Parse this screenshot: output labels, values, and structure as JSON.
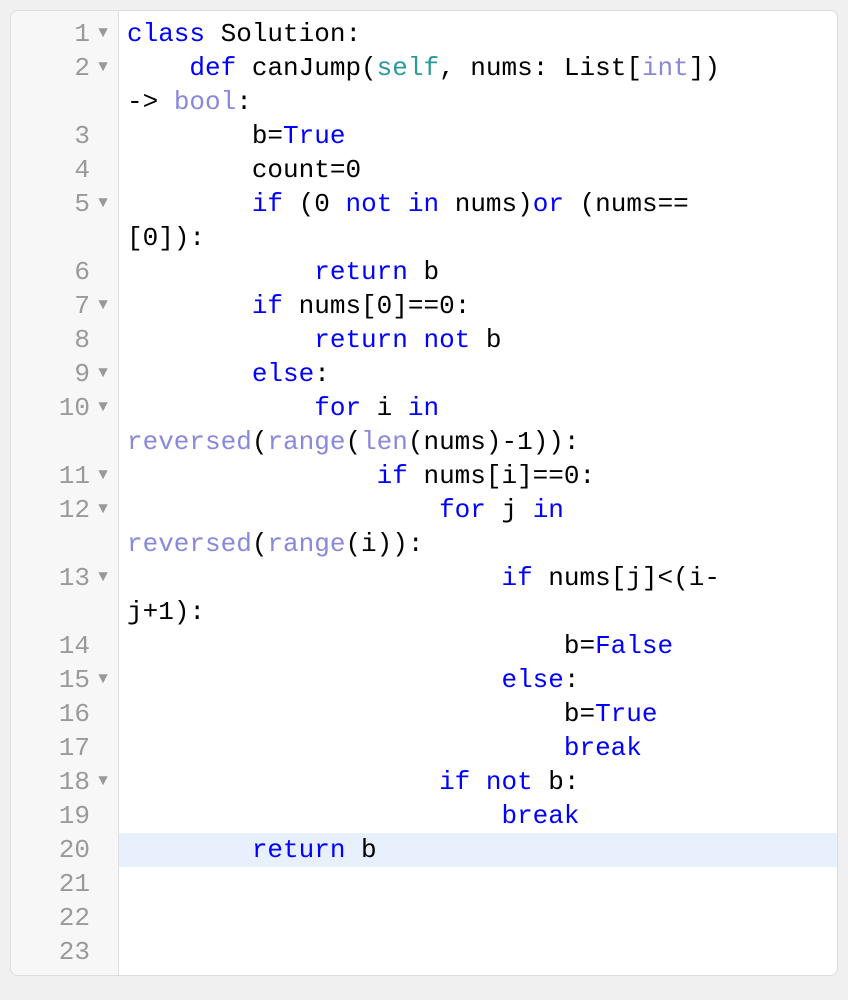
{
  "colors": {
    "keyword": "#0000ff",
    "default": "#000000",
    "self": "#2e9999",
    "type": "#8888dd",
    "builtin": "#8888dd",
    "number": "#000000",
    "highlight_bg": "#e8f0fe"
  },
  "gutter": [
    {
      "n": "1",
      "fold": true,
      "wraps": 0
    },
    {
      "n": "2",
      "fold": true,
      "wraps": 1
    },
    {
      "n": "3",
      "fold": false,
      "wraps": 0
    },
    {
      "n": "4",
      "fold": false,
      "wraps": 0
    },
    {
      "n": "5",
      "fold": true,
      "wraps": 1
    },
    {
      "n": "6",
      "fold": false,
      "wraps": 0
    },
    {
      "n": "7",
      "fold": true,
      "wraps": 0
    },
    {
      "n": "8",
      "fold": false,
      "wraps": 0
    },
    {
      "n": "9",
      "fold": true,
      "wraps": 0
    },
    {
      "n": "10",
      "fold": true,
      "wraps": 1
    },
    {
      "n": "11",
      "fold": true,
      "wraps": 0
    },
    {
      "n": "12",
      "fold": true,
      "wraps": 1
    },
    {
      "n": "13",
      "fold": true,
      "wraps": 1
    },
    {
      "n": "14",
      "fold": false,
      "wraps": 0
    },
    {
      "n": "15",
      "fold": true,
      "wraps": 0
    },
    {
      "n": "16",
      "fold": false,
      "wraps": 0
    },
    {
      "n": "17",
      "fold": false,
      "wraps": 0
    },
    {
      "n": "18",
      "fold": true,
      "wraps": 0
    },
    {
      "n": "19",
      "fold": false,
      "wraps": 0
    },
    {
      "n": "20",
      "fold": false,
      "wraps": 0,
      "hl": true
    },
    {
      "n": "21",
      "fold": false,
      "wraps": 0
    },
    {
      "n": "22",
      "fold": false,
      "wraps": 0
    },
    {
      "n": "23",
      "fold": false,
      "wraps": 0
    }
  ],
  "fold_glyph": "▼",
  "code_lines": [
    {
      "hl": false,
      "tokens": [
        [
          "kw",
          "class"
        ],
        [
          "def",
          " Solution:"
        ]
      ]
    },
    {
      "hl": false,
      "tokens": [
        [
          "def",
          "    "
        ],
        [
          "kw",
          "def"
        ],
        [
          "def",
          " canJump("
        ],
        [
          "self",
          "self"
        ],
        [
          "def",
          ", nums: List["
        ],
        [
          "type",
          "int"
        ],
        [
          "def",
          "]) "
        ]
      ]
    },
    {
      "hl": false,
      "tokens": [
        [
          "def",
          "-> "
        ],
        [
          "type",
          "bool"
        ],
        [
          "def",
          ":"
        ]
      ]
    },
    {
      "hl": false,
      "tokens": [
        [
          "def",
          "        b="
        ],
        [
          "kw",
          "True"
        ]
      ]
    },
    {
      "hl": false,
      "tokens": [
        [
          "def",
          "        count="
        ],
        [
          "def",
          "0"
        ]
      ]
    },
    {
      "hl": false,
      "tokens": [
        [
          "def",
          "        "
        ],
        [
          "kw",
          "if"
        ],
        [
          "def",
          " ("
        ],
        [
          "def",
          "0"
        ],
        [
          "def",
          " "
        ],
        [
          "kw",
          "not"
        ],
        [
          "def",
          " "
        ],
        [
          "kw",
          "in"
        ],
        [
          "def",
          " nums)"
        ],
        [
          "kw",
          "or"
        ],
        [
          "def",
          " (nums=="
        ]
      ]
    },
    {
      "hl": false,
      "tokens": [
        [
          "def",
          "["
        ],
        [
          "def",
          "0"
        ],
        [
          "def",
          "]):"
        ]
      ]
    },
    {
      "hl": false,
      "tokens": [
        [
          "def",
          "            "
        ],
        [
          "kw",
          "return"
        ],
        [
          "def",
          " b"
        ]
      ]
    },
    {
      "hl": false,
      "tokens": [
        [
          "def",
          "        "
        ],
        [
          "kw",
          "if"
        ],
        [
          "def",
          " nums["
        ],
        [
          "def",
          "0"
        ],
        [
          "def",
          "]=="
        ],
        [
          "def",
          "0"
        ],
        [
          "def",
          ":"
        ]
      ]
    },
    {
      "hl": false,
      "tokens": [
        [
          "def",
          "            "
        ],
        [
          "kw",
          "return"
        ],
        [
          "def",
          " "
        ],
        [
          "kw",
          "not"
        ],
        [
          "def",
          " b"
        ]
      ]
    },
    {
      "hl": false,
      "tokens": [
        [
          "def",
          "        "
        ],
        [
          "kw",
          "else"
        ],
        [
          "def",
          ":"
        ]
      ]
    },
    {
      "hl": false,
      "tokens": [
        [
          "def",
          "            "
        ],
        [
          "kw",
          "for"
        ],
        [
          "def",
          " i "
        ],
        [
          "kw",
          "in"
        ],
        [
          "def",
          " "
        ]
      ]
    },
    {
      "hl": false,
      "tokens": [
        [
          "builtin",
          "reversed"
        ],
        [
          "def",
          "("
        ],
        [
          "builtin",
          "range"
        ],
        [
          "def",
          "("
        ],
        [
          "builtin",
          "len"
        ],
        [
          "def",
          "(nums)-"
        ],
        [
          "def",
          "1"
        ],
        [
          "def",
          ")):"
        ]
      ]
    },
    {
      "hl": false,
      "tokens": [
        [
          "def",
          "                "
        ],
        [
          "kw",
          "if"
        ],
        [
          "def",
          " nums[i]=="
        ],
        [
          "def",
          "0"
        ],
        [
          "def",
          ":"
        ]
      ]
    },
    {
      "hl": false,
      "tokens": [
        [
          "def",
          "                    "
        ],
        [
          "kw",
          "for"
        ],
        [
          "def",
          " j "
        ],
        [
          "kw",
          "in"
        ],
        [
          "def",
          " "
        ]
      ]
    },
    {
      "hl": false,
      "tokens": [
        [
          "builtin",
          "reversed"
        ],
        [
          "def",
          "("
        ],
        [
          "builtin",
          "range"
        ],
        [
          "def",
          "(i)):"
        ]
      ]
    },
    {
      "hl": false,
      "tokens": [
        [
          "def",
          "                        "
        ],
        [
          "kw",
          "if"
        ],
        [
          "def",
          " nums[j]<(i-"
        ]
      ]
    },
    {
      "hl": false,
      "tokens": [
        [
          "def",
          "j+"
        ],
        [
          "def",
          "1"
        ],
        [
          "def",
          "):"
        ]
      ]
    },
    {
      "hl": false,
      "tokens": [
        [
          "def",
          "                            b="
        ],
        [
          "kw",
          "False"
        ]
      ]
    },
    {
      "hl": false,
      "tokens": [
        [
          "def",
          "                        "
        ],
        [
          "kw",
          "else"
        ],
        [
          "def",
          ":"
        ]
      ]
    },
    {
      "hl": false,
      "tokens": [
        [
          "def",
          "                            b="
        ],
        [
          "kw",
          "True"
        ]
      ]
    },
    {
      "hl": false,
      "tokens": [
        [
          "def",
          "                            "
        ],
        [
          "kw",
          "break"
        ]
      ]
    },
    {
      "hl": false,
      "tokens": [
        [
          "def",
          "                    "
        ],
        [
          "kw",
          "if"
        ],
        [
          "def",
          " "
        ],
        [
          "kw",
          "not"
        ],
        [
          "def",
          " b:"
        ]
      ]
    },
    {
      "hl": false,
      "tokens": [
        [
          "def",
          "                        "
        ],
        [
          "kw",
          "break"
        ]
      ]
    },
    {
      "hl": true,
      "tokens": [
        [
          "def",
          "        "
        ],
        [
          "kw",
          "return"
        ],
        [
          "def",
          " b"
        ]
      ]
    },
    {
      "hl": false,
      "tokens": [
        [
          "def",
          ""
        ]
      ]
    },
    {
      "hl": false,
      "tokens": [
        [
          "def",
          ""
        ]
      ]
    },
    {
      "hl": false,
      "tokens": [
        [
          "def",
          ""
        ]
      ]
    }
  ]
}
